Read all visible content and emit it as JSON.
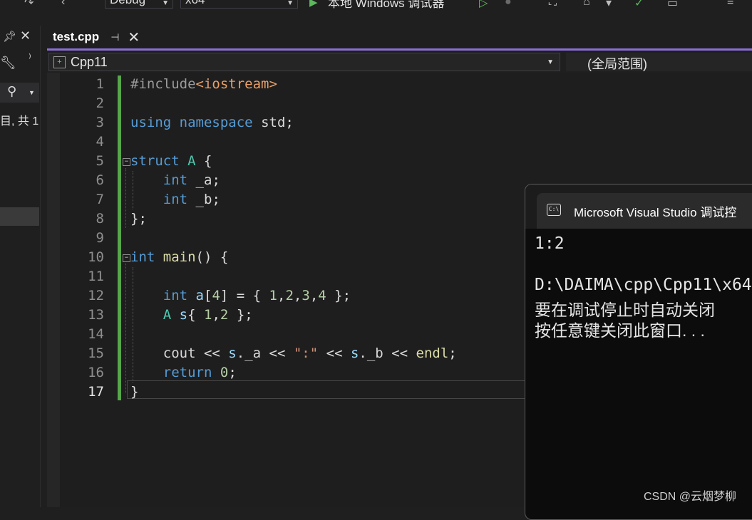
{
  "toolbar": {
    "configuration": "Debug",
    "platform": "x64",
    "debugger_label": "本地 Windows 调试器"
  },
  "left_panel": {
    "partial_text": "目, 共 1"
  },
  "tab": {
    "filename": "test.cpp"
  },
  "navbar": {
    "project": "Cpp11",
    "scope": "(全局范围)"
  },
  "editor": {
    "current_line": 17,
    "lines": [
      {
        "n": "1",
        "text": "#include<iostream>"
      },
      {
        "n": "2",
        "text": ""
      },
      {
        "n": "3",
        "text": "using namespace std;"
      },
      {
        "n": "4",
        "text": ""
      },
      {
        "n": "5",
        "text": "struct A {"
      },
      {
        "n": "6",
        "text": "    int _a;"
      },
      {
        "n": "7",
        "text": "    int _b;"
      },
      {
        "n": "8",
        "text": "};"
      },
      {
        "n": "9",
        "text": ""
      },
      {
        "n": "10",
        "text": "int main() {"
      },
      {
        "n": "11",
        "text": ""
      },
      {
        "n": "12",
        "text": "    int a[4] = { 1,2,3,4 };"
      },
      {
        "n": "13",
        "text": "    A s{ 1,2 };"
      },
      {
        "n": "14",
        "text": ""
      },
      {
        "n": "15",
        "text": "    cout << s._a << \":\" << s._b << endl;"
      },
      {
        "n": "16",
        "text": "    return 0;"
      },
      {
        "n": "17",
        "text": "}"
      }
    ]
  },
  "console": {
    "title": "Microsoft Visual Studio 调试控",
    "output_line1": "1:2",
    "output_line2": "D:\\DAIMA\\cpp\\Cpp11\\x64",
    "output_line3": "要在调试停止时自动关闭",
    "output_line4": "按任意键关闭此窗口. . ."
  },
  "watermark": "CSDN @云烟梦柳"
}
